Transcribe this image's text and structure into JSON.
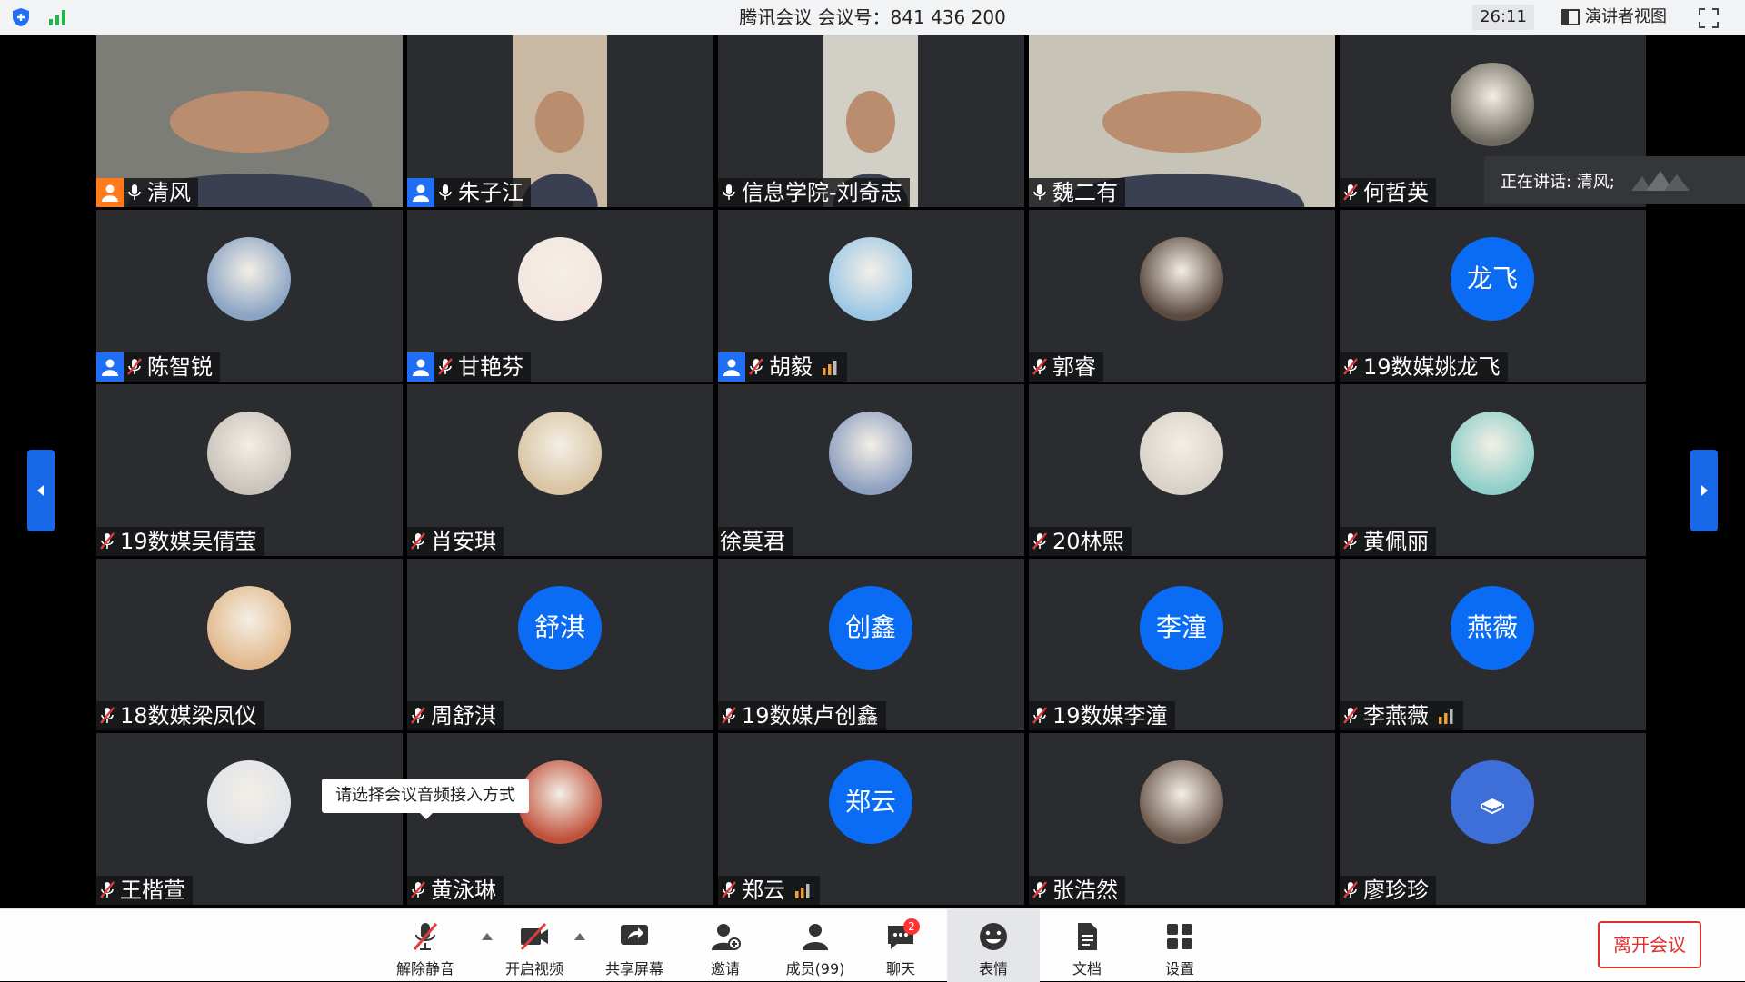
{
  "titlebar": {
    "title": "腾讯会议 会议号：841 436 200",
    "timer": "26:11",
    "view_mode": "演讲者视图"
  },
  "speaking": "正在讲话: 清风;",
  "tooltip": "请选择会议音频接入方式",
  "participants": [
    {
      "name": "清风",
      "mic": "on",
      "host": "orange",
      "media": "video",
      "bg": "#7d7d78"
    },
    {
      "name": "朱子江",
      "mic": "on",
      "host": "blue",
      "media": "video",
      "bg": "#c9b9a2"
    },
    {
      "name": "信息学院-刘奇志",
      "mic": "on",
      "media": "video",
      "bg": "#d2cfc6"
    },
    {
      "name": "魏二有",
      "mic": "on",
      "media": "video",
      "bg": "#c7c3b7"
    },
    {
      "name": "何哲英",
      "mic": "muted",
      "media": "photo",
      "photo": "#6f6a60"
    },
    {
      "name": "陈智锐",
      "mic": "muted",
      "host": "blue",
      "media": "photo",
      "photo": "#8aa4c4"
    },
    {
      "name": "甘艳芬",
      "mic": "muted",
      "host": "blue",
      "media": "photo",
      "photo": "#f3e6e0"
    },
    {
      "name": "胡毅",
      "mic": "muted",
      "host": "blue",
      "media": "photo",
      "photo": "#9cc8e6",
      "signal": true
    },
    {
      "name": "郭睿",
      "mic": "muted",
      "media": "photo",
      "photo": "#5b4a40"
    },
    {
      "name": "19数媒姚龙飞",
      "mic": "muted",
      "media": "text",
      "avatar_text": "龙飞"
    },
    {
      "name": "19数媒吴倩莹",
      "mic": "muted",
      "media": "photo",
      "photo": "#c9c3bb"
    },
    {
      "name": "肖安琪",
      "mic": "muted",
      "media": "photo",
      "photo": "#d9c4a3"
    },
    {
      "name": "徐莫君",
      "mic": "none",
      "media": "photo",
      "photo": "#8ea0c0"
    },
    {
      "name": "20林熙",
      "mic": "muted",
      "media": "photo",
      "photo": "#d8d2c8"
    },
    {
      "name": "黄佩丽",
      "mic": "muted",
      "media": "photo",
      "photo": "#8fcfc9"
    },
    {
      "name": "18数媒梁凤仪",
      "mic": "muted",
      "media": "photo",
      "photo": "#e2b98c"
    },
    {
      "name": "周舒淇",
      "mic": "muted",
      "media": "text",
      "avatar_text": "舒淇"
    },
    {
      "name": "19数媒卢创鑫",
      "mic": "muted",
      "media": "text",
      "avatar_text": "创鑫"
    },
    {
      "name": "19数媒李潼",
      "mic": "muted",
      "media": "text",
      "avatar_text": "李潼"
    },
    {
      "name": "李燕薇",
      "mic": "muted",
      "media": "text",
      "avatar_text": "燕薇",
      "signal": true
    },
    {
      "name": "王楷萱",
      "mic": "muted",
      "media": "photo",
      "photo": "#dfe3ea"
    },
    {
      "name": "黄泳琳",
      "mic": "muted",
      "media": "photo",
      "photo": "#c0503a"
    },
    {
      "name": "郑云",
      "mic": "muted",
      "media": "text",
      "avatar_text": "郑云",
      "signal": true
    },
    {
      "name": "张浩然",
      "mic": "muted",
      "media": "photo",
      "photo": "#6e5a4e"
    },
    {
      "name": "廖珍珍",
      "mic": "muted",
      "media": "book"
    }
  ],
  "toolbar": {
    "unmute": "解除静音",
    "video": "开启视频",
    "share": "共享屏幕",
    "invite": "邀请",
    "members": "成员(99)",
    "chat": "聊天",
    "chat_badge": "2",
    "reaction": "表情",
    "docs": "文档",
    "settings": "设置",
    "leave": "离开会议"
  }
}
